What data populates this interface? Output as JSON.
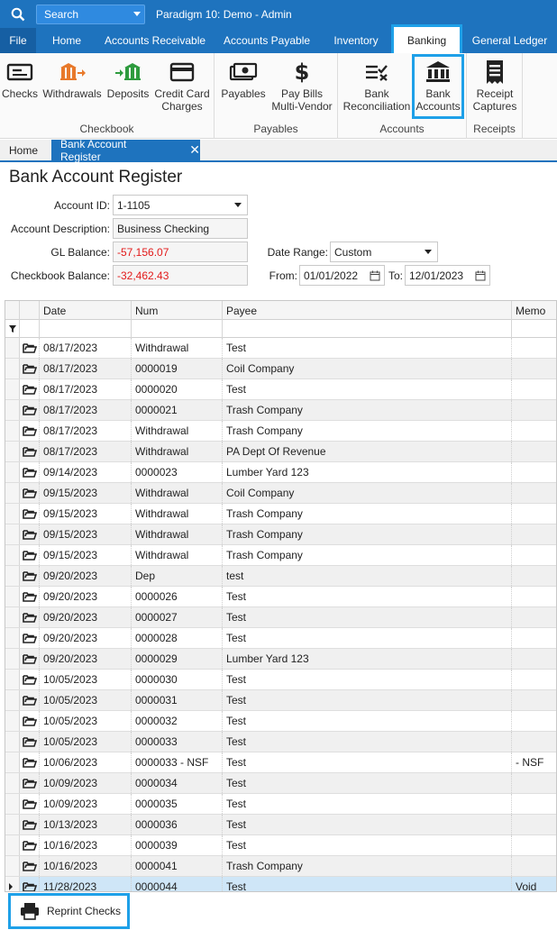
{
  "titlebar": {
    "search_placeholder": "Search",
    "title": "Paradigm 10: Demo - Admin"
  },
  "menu": {
    "file": "File",
    "tabs": [
      "Home",
      "Accounts Receivable",
      "Accounts Payable",
      "Inventory",
      "Banking",
      "General Ledger"
    ],
    "active": "Banking"
  },
  "ribbon": {
    "groups": [
      {
        "label": "Checkbook",
        "buttons": [
          {
            "label": "Checks",
            "icon": "checks-icon"
          },
          {
            "label": "Withdrawals",
            "icon": "withdrawals-icon"
          },
          {
            "label": "Deposits",
            "icon": "deposits-icon"
          },
          {
            "label": "Credit Card\nCharges",
            "icon": "credit-card-icon"
          }
        ]
      },
      {
        "label": "Payables",
        "buttons": [
          {
            "label": "Payables",
            "icon": "payables-icon"
          },
          {
            "label": "Pay Bills\nMulti-Vendor",
            "icon": "dollar-icon"
          }
        ]
      },
      {
        "label": "Accounts",
        "buttons": [
          {
            "label": "Bank\nReconciliation",
            "icon": "reconcile-icon"
          },
          {
            "label": "Bank\nAccounts",
            "icon": "bank-icon"
          }
        ]
      },
      {
        "label": "Receipts",
        "buttons": [
          {
            "label": "Receipt\nCaptures",
            "icon": "receipt-icon"
          }
        ]
      }
    ]
  },
  "doctabs": {
    "home": "Home",
    "active": "Bank Account Register"
  },
  "form": {
    "page_title": "Bank Account Register",
    "account_id_label": "Account ID:",
    "account_id": "1-1105",
    "account_desc_label": "Account Description:",
    "account_desc": "Business Checking",
    "gl_balance_label": "GL Balance:",
    "gl_balance": "-57,156.07",
    "checkbook_balance_label": "Checkbook Balance:",
    "checkbook_balance": "-32,462.43",
    "date_range_label": "Date Range:",
    "date_range": "Custom",
    "from_label": "From:",
    "from": "01/01/2022",
    "to_label": "To:",
    "to": "12/01/2023"
  },
  "grid": {
    "columns": [
      "Date",
      "Num",
      "Payee",
      "Memo"
    ],
    "rows": [
      {
        "date": "08/17/2023",
        "num": "Withdrawal",
        "payee": "Test",
        "memo": ""
      },
      {
        "date": "08/17/2023",
        "num": "0000019",
        "payee": "Coil Company",
        "memo": ""
      },
      {
        "date": "08/17/2023",
        "num": "0000020",
        "payee": "Test",
        "memo": ""
      },
      {
        "date": "08/17/2023",
        "num": "0000021",
        "payee": "Trash Company",
        "memo": ""
      },
      {
        "date": "08/17/2023",
        "num": "Withdrawal",
        "payee": "Trash Company",
        "memo": ""
      },
      {
        "date": "08/17/2023",
        "num": "Withdrawal",
        "payee": "PA Dept Of Revenue",
        "memo": ""
      },
      {
        "date": "09/14/2023",
        "num": "0000023",
        "payee": "Lumber Yard 123",
        "memo": ""
      },
      {
        "date": "09/15/2023",
        "num": "Withdrawal",
        "payee": "Coil Company",
        "memo": ""
      },
      {
        "date": "09/15/2023",
        "num": "Withdrawal",
        "payee": "Trash Company",
        "memo": ""
      },
      {
        "date": "09/15/2023",
        "num": "Withdrawal",
        "payee": "Trash Company",
        "memo": ""
      },
      {
        "date": "09/15/2023",
        "num": "Withdrawal",
        "payee": "Trash Company",
        "memo": ""
      },
      {
        "date": "09/20/2023",
        "num": "Dep",
        "payee": "test",
        "memo": ""
      },
      {
        "date": "09/20/2023",
        "num": "0000026",
        "payee": "Test",
        "memo": ""
      },
      {
        "date": "09/20/2023",
        "num": "0000027",
        "payee": "Test",
        "memo": ""
      },
      {
        "date": "09/20/2023",
        "num": "0000028",
        "payee": "Test",
        "memo": ""
      },
      {
        "date": "09/20/2023",
        "num": "0000029",
        "payee": "Lumber Yard 123",
        "memo": ""
      },
      {
        "date": "10/05/2023",
        "num": "0000030",
        "payee": "Test",
        "memo": ""
      },
      {
        "date": "10/05/2023",
        "num": "0000031",
        "payee": "Test",
        "memo": ""
      },
      {
        "date": "10/05/2023",
        "num": "0000032",
        "payee": "Test",
        "memo": ""
      },
      {
        "date": "10/05/2023",
        "num": "0000033",
        "payee": "Test",
        "memo": ""
      },
      {
        "date": "10/06/2023",
        "num": "0000033 - NSF",
        "payee": "Test",
        "memo": " - NSF"
      },
      {
        "date": "10/09/2023",
        "num": "0000034",
        "payee": "Test",
        "memo": ""
      },
      {
        "date": "10/09/2023",
        "num": "0000035",
        "payee": "Test",
        "memo": ""
      },
      {
        "date": "10/13/2023",
        "num": "0000036",
        "payee": "Test",
        "memo": ""
      },
      {
        "date": "10/16/2023",
        "num": "0000039",
        "payee": "Test",
        "memo": ""
      },
      {
        "date": "10/16/2023",
        "num": "0000041",
        "payee": "Trash Company",
        "memo": ""
      },
      {
        "date": "11/28/2023",
        "num": "0000044",
        "payee": "Test",
        "memo": "Void",
        "selected": true
      }
    ]
  },
  "footer": {
    "reprint_label": "Reprint Checks"
  }
}
